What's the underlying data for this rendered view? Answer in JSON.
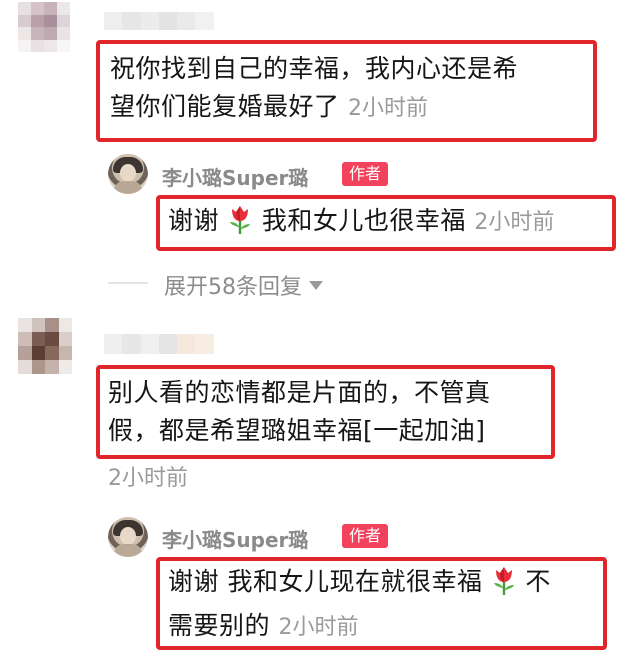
{
  "thread": [
    {
      "comment_text": "祝你找到自己的幸福，我内心还是希望你们能复婚最好了",
      "comment_line1": "祝你找到自己的幸福，我内心还是希",
      "comment_line2": "望你们能复婚最好了",
      "comment_time": "2小时前",
      "reply": {
        "username": "李小璐Super璐",
        "badge": "作者",
        "text_before_icon": "谢谢",
        "icon": "tulip-icon",
        "text_after_icon": "我和女儿也很幸福",
        "time": "2小时前"
      },
      "expand_label": "展开58条回复"
    },
    {
      "comment_text": "别人看的恋情都是片面的，不管真假，都是希望璐姐幸福[一起加油]",
      "comment_line1": "别人看的恋情都是片面的，不管真",
      "comment_line2": "假，都是希望璐姐幸福[一起加油]",
      "comment_time": "2小时前",
      "reply": {
        "username": "李小璐Super璐",
        "badge": "作者",
        "text_before_icon": "谢谢 我和女儿现在就很幸福",
        "icon": "tulip-icon",
        "text_after_icon": "不",
        "text_line2": "需要别的",
        "time": "2小时前"
      }
    }
  ],
  "colors": {
    "highlight_border": "#e0262b",
    "author_badge": "#f2425c",
    "timestamp": "#9a9a9a"
  }
}
